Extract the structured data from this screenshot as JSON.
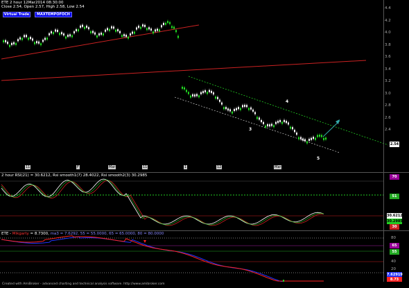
{
  "price_pane": {
    "title_line1": "ETE  2 hour  12Mar2014 08:30:00",
    "title_line2": "Close 2.54, Open 2.57, High 2.58, Low 2.54",
    "buttons": [
      "Virtual Trade",
      "MAXTEMPOFOCH"
    ],
    "y_ticks": [
      "4.4",
      "4.2",
      "4.0",
      "3.8",
      "3.6",
      "3.4",
      "3.2",
      "3.0",
      "2.8",
      "2.6",
      "2.4"
    ],
    "last_price": "2.54",
    "wave_labels": [
      "3",
      "4",
      "5"
    ],
    "x_labels": [
      "11",
      "F",
      "Mar",
      "11",
      "1",
      "12",
      "Mar"
    ]
  },
  "rsi_pane": {
    "title": "2 hour RSI(21) = 30.6212, Rsi smooth1(7) 28.4022, Rsi smooth2(3) 30.2985",
    "ticks": [
      "70",
      "51",
      "30"
    ],
    "value_tags": [
      "30.6212",
      "30.2985",
      "30"
    ]
  },
  "indicator_pane": {
    "title_prefix": "ETE - ",
    "title_name": "Mikgarty",
    "title_value": " = 8.7300, ",
    "title_rest": "ma3 = 7.6292, 55 = 55.0000, 65 = 65.0000, 80 = 80.0000",
    "ticks": [
      "80",
      "65",
      "55",
      "40",
      "20"
    ],
    "value_tags": [
      "7.62919",
      "8.73"
    ]
  },
  "footer": {
    "text": "Created with AmiBroker - advanced charting and technical analysis software. http://www.amibroker.com"
  },
  "colors": {
    "background": "#000000",
    "up_candle": "#ffffff",
    "down_candle": "#22dd22",
    "trend_red": "#cc2222",
    "channel_green": "#22cc22",
    "rsi_line": "#ffffff",
    "ind_red": "#ff2222",
    "ind_blue": "#2233ff"
  }
}
